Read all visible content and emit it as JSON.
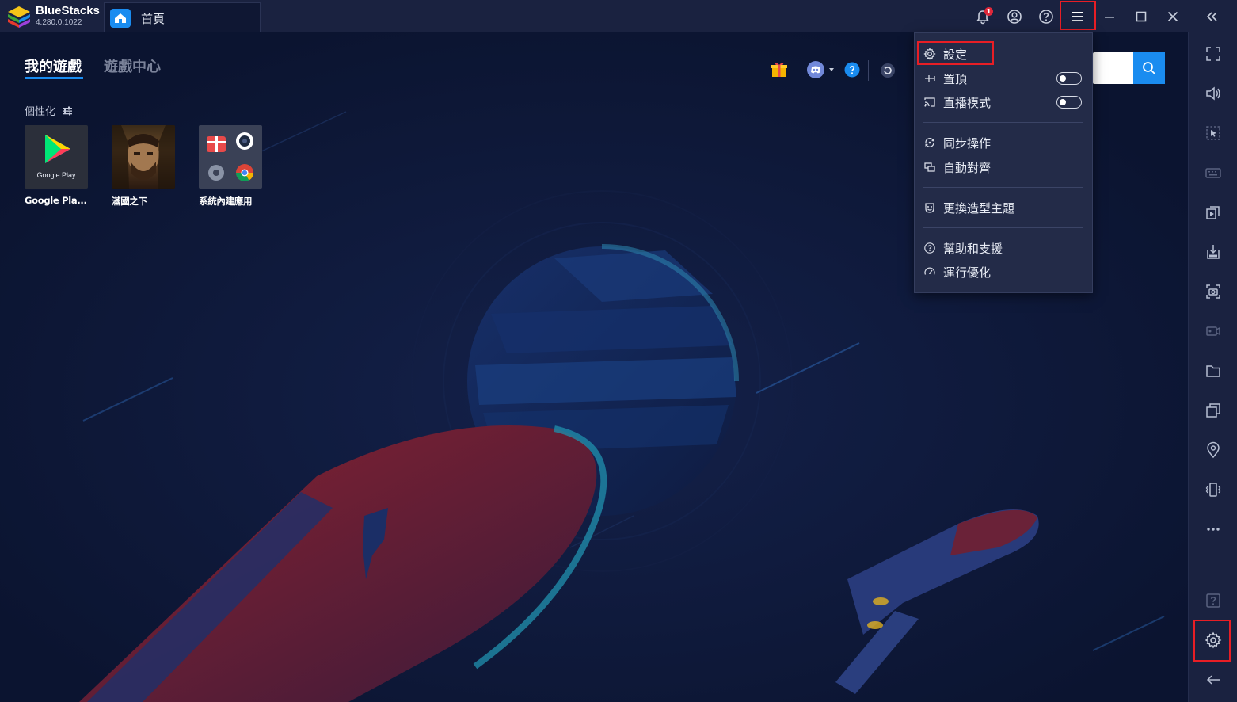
{
  "app": {
    "name": "BlueStacks",
    "version": "4.280.0.1022",
    "tab_label": "首頁",
    "notification_count": "1"
  },
  "nav": {
    "tabs": [
      {
        "label": "我的遊戲",
        "active": true
      },
      {
        "label": "遊戲中心",
        "active": false
      }
    ],
    "personalize_label": "個性化"
  },
  "apps": [
    {
      "label": "Google Pla...",
      "icon": "google-play-icon",
      "sublabel": "Google Play"
    },
    {
      "label": "滿國之下",
      "icon": "game-portrait-icon"
    },
    {
      "label": "系統內建應用",
      "icon": "system-apps-folder-icon"
    }
  ],
  "menu": {
    "items": [
      {
        "label": "設定",
        "icon": "gear-icon"
      },
      {
        "label": "置頂",
        "icon": "pin-icon",
        "toggle": false
      },
      {
        "label": "直播模式",
        "icon": "cast-icon",
        "toggle": false
      },
      {
        "label": "同步操作",
        "icon": "sync-icon"
      },
      {
        "label": "自動對齊",
        "icon": "align-windows-icon"
      },
      {
        "label": "更換造型主題",
        "icon": "theme-icon"
      },
      {
        "label": "幫助和支援",
        "icon": "help-circle-icon"
      },
      {
        "label": "運行優化",
        "icon": "speedometer-icon"
      }
    ]
  },
  "colors": {
    "accent": "#1a8cf0",
    "highlight": "#e81e25",
    "titlebar": "#1a2240",
    "background": "#0d1632"
  }
}
